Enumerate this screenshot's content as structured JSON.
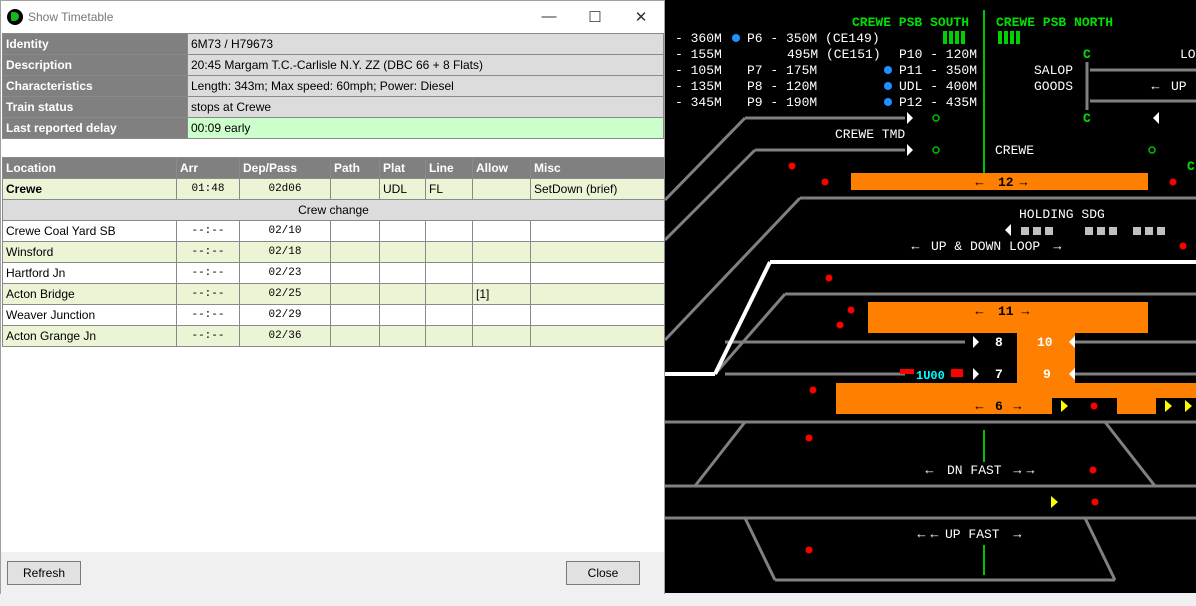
{
  "window": {
    "title": "Show Timetable",
    "minimize": "—",
    "maximize": "☐",
    "close": "✕"
  },
  "info": [
    {
      "label": "Identity",
      "value": "6M73 / H79673"
    },
    {
      "label": "Description",
      "value": "20:45 Margam T.C.-Carlisle N.Y. ZZ (DBC 66 + 8 Flats)"
    },
    {
      "label": "Characteristics",
      "value": "Length: 343m; Max speed: 60mph; Power: Diesel"
    },
    {
      "label": "Train status",
      "value": "stops at Crewe"
    },
    {
      "label": "Last reported delay",
      "value": "00:09 early"
    }
  ],
  "schedule": {
    "headers": [
      "Location",
      "Arr",
      "Dep/Pass",
      "Path",
      "Plat",
      "Line",
      "Allow",
      "Misc"
    ],
    "first_row": {
      "location": "Crewe",
      "arr": "01:48",
      "dep": "02d06",
      "path": "",
      "plat": "UDL",
      "line": "FL",
      "allow": "",
      "misc": "SetDown (brief)"
    },
    "crew_change": "Crew change",
    "rows": [
      {
        "location": "Crewe Coal Yard SB",
        "arr": "--:--",
        "dep": "02/10",
        "allow": ""
      },
      {
        "location": "Winsford",
        "arr": "--:--",
        "dep": "02/18",
        "allow": ""
      },
      {
        "location": "Hartford Jn",
        "arr": "--:--",
        "dep": "02/23",
        "allow": ""
      },
      {
        "location": "Acton Bridge",
        "arr": "--:--",
        "dep": "02/25",
        "allow": "[1]"
      },
      {
        "location": "Weaver Junction",
        "arr": "--:--",
        "dep": "02/29",
        "allow": ""
      },
      {
        "location": "Acton Grange Jn",
        "arr": "--:--",
        "dep": "02/36",
        "allow": ""
      }
    ]
  },
  "buttons": {
    "refresh": "Refresh",
    "close": "Close"
  },
  "panel": {
    "title_south": "CREWE PSB SOUTH",
    "title_north": "CREWE PSB NORTH",
    "lengths_col1": [
      "- 360M",
      "- 155M",
      "- 105M",
      "- 135M",
      "- 345M"
    ],
    "lengths_col2": [
      "P6 - 350M (CE149)",
      "495M (CE151)",
      "P7 - 175M",
      "P8 - 120M",
      "P9 - 190M"
    ],
    "lengths_col3": [
      "",
      "P10 - 120M",
      "P11 - 350M",
      "UDL - 400M",
      "P12 - 435M"
    ],
    "labels": {
      "salop": "SALOP",
      "goods": "GOODS",
      "up": "UP",
      "lo": "LO",
      "crewe_tmd": "CREWE TMD",
      "crewe": "CREWE",
      "holding_sdg": "HOLDING SDG",
      "up_down_loop": "UP & DOWN LOOP",
      "dn_fast": "DN FAST",
      "up_fast": "UP FAST",
      "c1": "C",
      "c2": "C",
      "c3": "C",
      "train_id": "1U00"
    },
    "platforms": [
      "12",
      "11",
      "10",
      "9",
      "8",
      "7",
      "6"
    ],
    "colors": {
      "occupied": "#ff8000",
      "track": "#808080",
      "title": "#00e000",
      "text": "#ffffff",
      "signal_red": "#ff0000"
    }
  }
}
